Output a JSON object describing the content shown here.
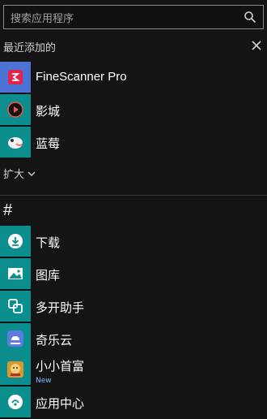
{
  "search": {
    "placeholder": "搜索应用程序"
  },
  "recent": {
    "title": "最近添加的",
    "apps": [
      {
        "label": "FineScanner Pro",
        "color": "#4b74d6"
      },
      {
        "label": "影城",
        "color": "#0d8e8e"
      },
      {
        "label": "蓝莓",
        "color": "#0d8e8e"
      }
    ],
    "expand_label": "扩大"
  },
  "group": {
    "header": "#",
    "apps": [
      {
        "label": "下载",
        "color": "#0d8e8e"
      },
      {
        "label": "图库",
        "color": "#0d8e8e"
      },
      {
        "label": "多开助手",
        "color": "#0d8e8e"
      },
      {
        "label": "奇乐云",
        "color": "#0d8e8e"
      },
      {
        "label": "小小首富",
        "color": "#0d8e8e",
        "badge": "New"
      },
      {
        "label": "应用中心",
        "color": "#0d8e8e"
      }
    ]
  }
}
